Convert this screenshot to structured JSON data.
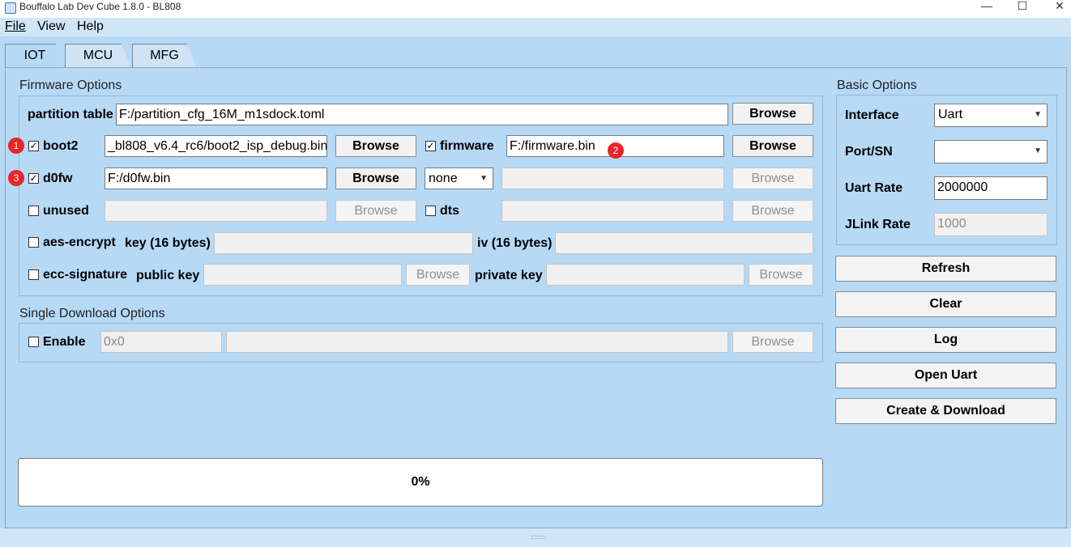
{
  "window": {
    "title": "Bouffalo Lab Dev Cube 1.8.0 - BL808",
    "minimize": "—",
    "maximize": "☐",
    "close": "✕"
  },
  "menu": {
    "file": "File",
    "view": "View",
    "help": "Help"
  },
  "tabs": [
    {
      "label": "IOT"
    },
    {
      "label": "MCU"
    },
    {
      "label": "MFG"
    }
  ],
  "firmware_options": {
    "title": "Firmware Options",
    "partition_table": {
      "label": "partition table",
      "value": "F:/partition_cfg_16M_m1sdock.toml",
      "browse": "Browse"
    },
    "boot2": {
      "label": "boot2",
      "checked": "✓",
      "value": "_bl808_v6.4_rc6/boot2_isp_debug.bin",
      "browse": "Browse"
    },
    "firmware": {
      "label": "firmware",
      "checked": "✓",
      "value": "F:/firmware.bin",
      "browse": "Browse"
    },
    "d0fw": {
      "label": "d0fw",
      "checked": "✓",
      "value": "F:/d0fw.bin",
      "browse": "Browse"
    },
    "core_select": {
      "value": "none",
      "path": "",
      "browse": "Browse"
    },
    "unused": {
      "label": "unused",
      "value": "",
      "browse": "Browse"
    },
    "dts": {
      "label": "dts",
      "value": "",
      "browse": "Browse"
    },
    "aes_encrypt": {
      "label": "aes-encrypt",
      "key_label": "key (16 bytes)",
      "key_value": "",
      "iv_label": "iv (16 bytes)",
      "iv_value": ""
    },
    "ecc_signature": {
      "label": "ecc-signature",
      "public_key_label": "public key",
      "public_browse": "Browse",
      "private_key_label": "private key",
      "private_browse": "Browse"
    }
  },
  "annotations": {
    "one": "1",
    "two": "2",
    "three": "3"
  },
  "single_download": {
    "title": "Single Download Options",
    "enable_label": "Enable",
    "address_placeholder": "0x0",
    "path": "",
    "browse": "Browse"
  },
  "basic_options": {
    "title": "Basic Options",
    "interface_label": "Interface",
    "interface_value": "Uart",
    "port_label": "Port/SN",
    "port_value": "",
    "uart_rate_label": "Uart Rate",
    "uart_rate_value": "2000000",
    "jlink_rate_label": "JLink Rate",
    "jlink_rate_value": "1000"
  },
  "actions": {
    "refresh": "Refresh",
    "clear": "Clear",
    "log": "Log",
    "open_uart": "Open Uart",
    "create_download": "Create & Download"
  },
  "progress": {
    "text": "0%",
    "value": 0
  },
  "colors": {
    "surface": "#b6d9f6",
    "badge": "#e8252a"
  }
}
